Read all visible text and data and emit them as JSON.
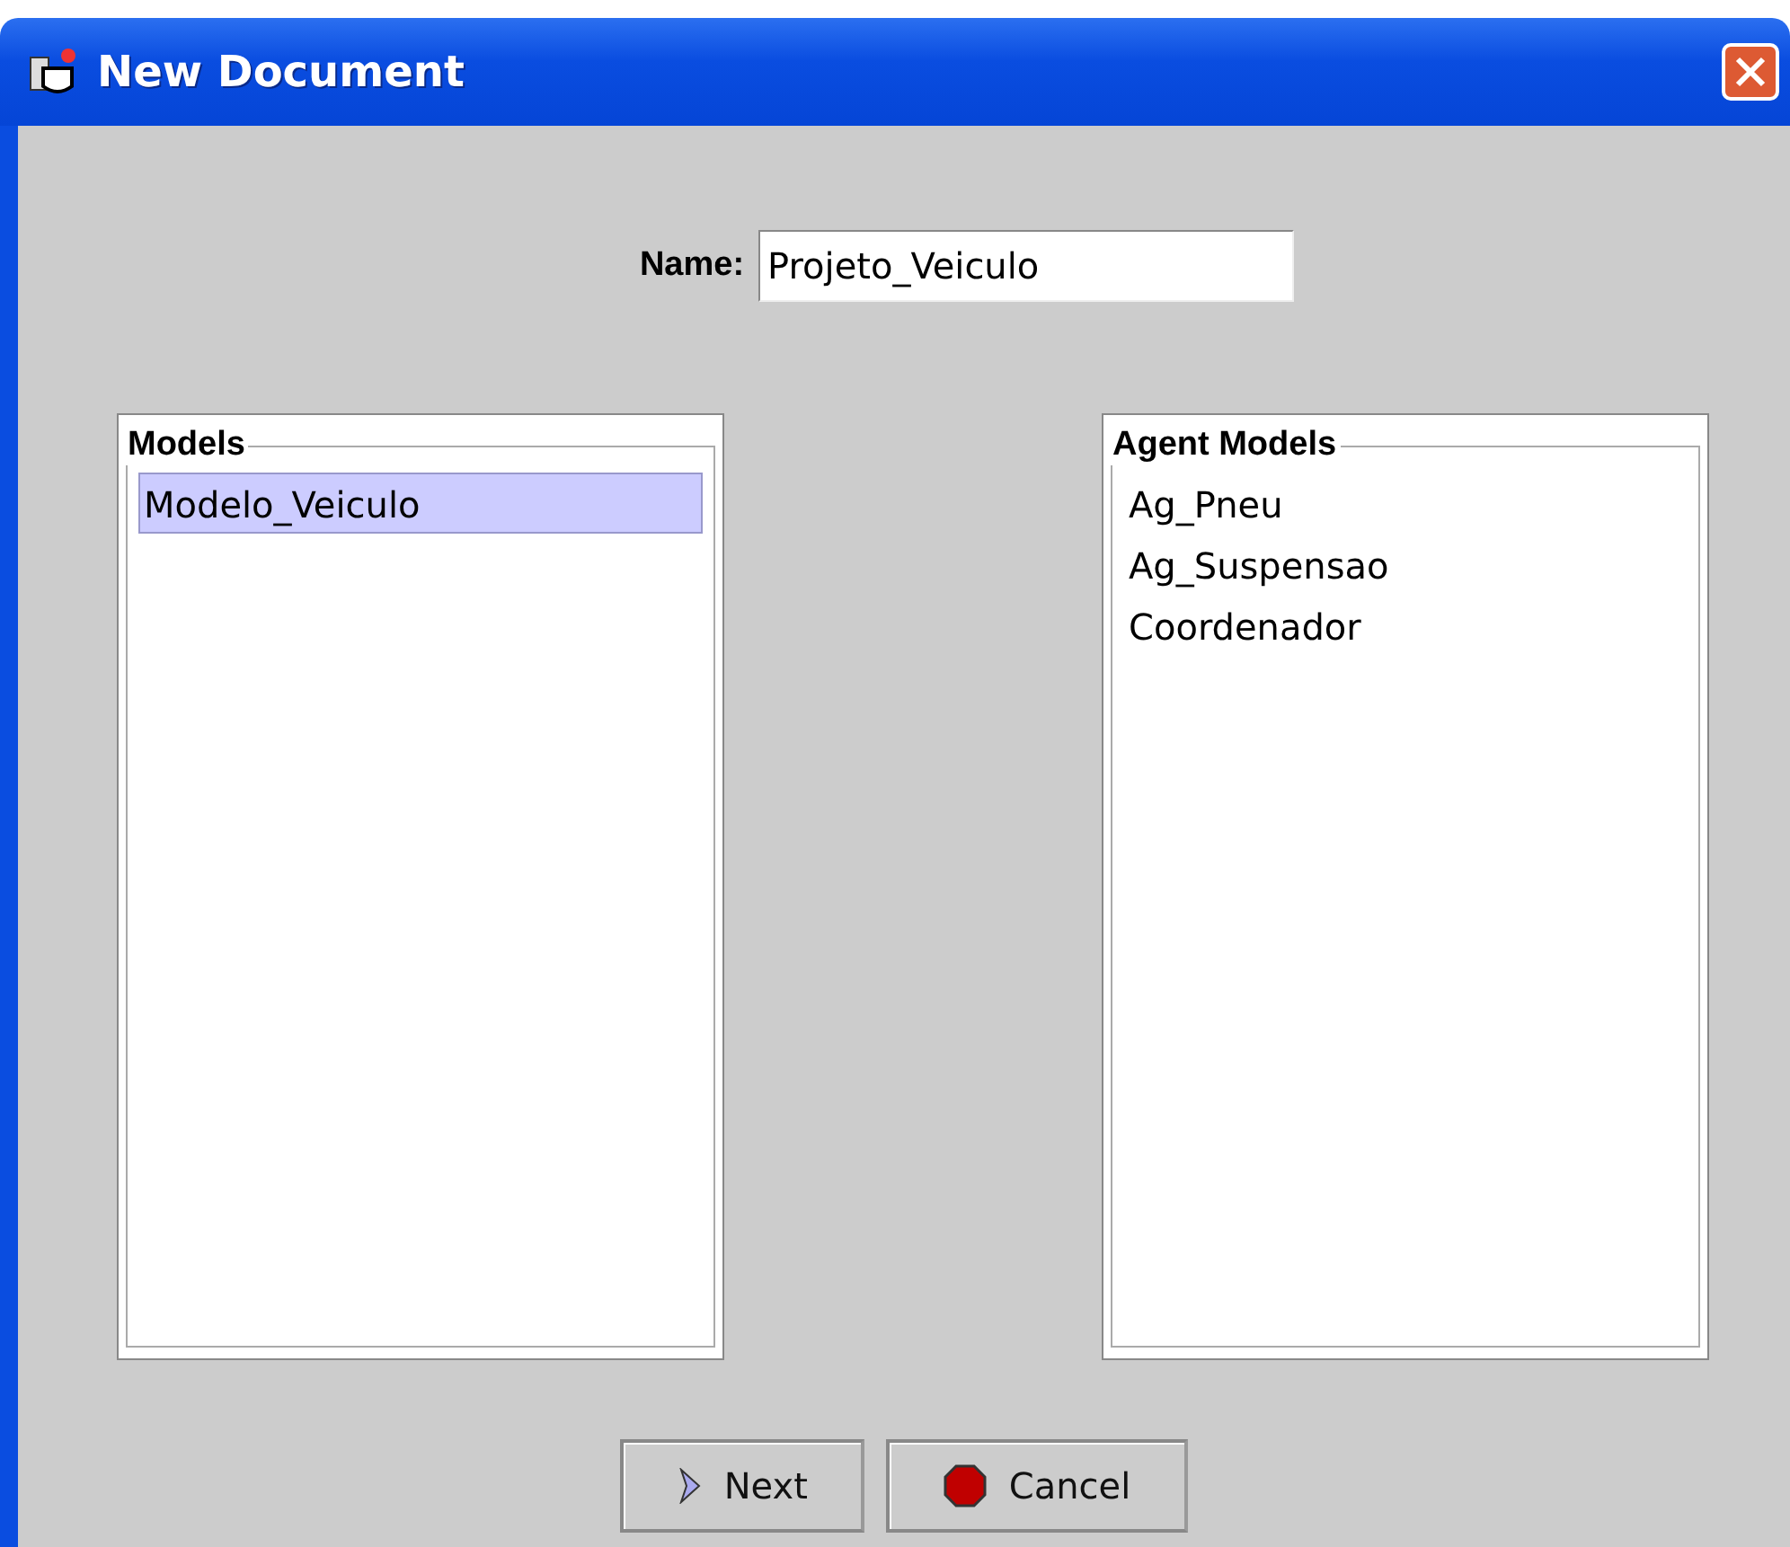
{
  "window": {
    "title": "New Document"
  },
  "name_field": {
    "label": "Name:",
    "value": "Projeto_Veiculo"
  },
  "lists": [
    {
      "title": "Models",
      "items": [
        {
          "label": "Modelo_Veiculo",
          "selected": true
        }
      ]
    },
    {
      "title": "Agent Models",
      "items": [
        {
          "label": "Ag_Pneu",
          "selected": false
        },
        {
          "label": "Ag_Suspensao",
          "selected": false
        },
        {
          "label": "Coordenador",
          "selected": false
        }
      ]
    }
  ],
  "buttons": [
    {
      "kind": "next",
      "label": "Next"
    },
    {
      "kind": "cancel",
      "label": "Cancel"
    }
  ]
}
